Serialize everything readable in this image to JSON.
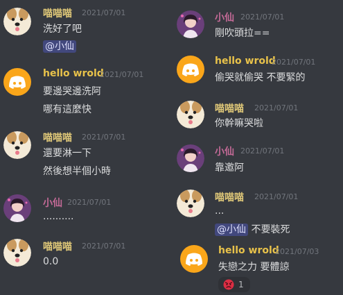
{
  "colors": {
    "background": "#36393f",
    "user_a_name": "#e0c878",
    "user_b_name": "#c46a97",
    "user_c_name": "#e8c24a",
    "discord_avatar_bg": "#faa61a",
    "mention_bg": "#4a4f8a"
  },
  "left_messages": [
    {
      "author": "喵喵喵",
      "timestamp": "2021/07/01",
      "lines": [
        "洗好了吧"
      ],
      "mention": "@小仙"
    },
    {
      "author": "hello wrold",
      "timestamp": "2021/07/01",
      "lines": [
        "要邊哭邊洗阿",
        "哪有這麼快"
      ]
    },
    {
      "author": "喵喵喵",
      "timestamp": "2021/07/01",
      "lines": [
        "還要淋一下",
        "然後想半個小時"
      ]
    },
    {
      "author": "小仙",
      "timestamp": "2021/07/01",
      "lines": [
        ".........."
      ]
    },
    {
      "author": "喵喵喵",
      "timestamp": "2021/07/01",
      "lines": [
        "0.0"
      ]
    }
  ],
  "right_messages": [
    {
      "author": "小仙",
      "timestamp": "2021/07/01",
      "lines": [
        "剛吹頭拉=="
      ]
    },
    {
      "author": "hello wrold",
      "timestamp": "2021/07/01",
      "lines": [
        "偷哭就偷哭 不要緊的"
      ]
    },
    {
      "author": "喵喵喵",
      "timestamp": "2021/07/01",
      "lines": [
        "你幹嘛哭啦"
      ]
    },
    {
      "author": "小仙",
      "timestamp": "2021/07/01",
      "lines": [
        "靠邀阿"
      ]
    },
    {
      "author": "喵喵喵",
      "timestamp": "2021/07/01",
      "lines": [
        "..."
      ],
      "mention": "@小仙",
      "mention_suffix": " 不要裝死"
    },
    {
      "author": "hello wrold",
      "timestamp": "2021/07/03",
      "lines": [
        "失戀之力 要體諒"
      ],
      "reaction": {
        "emoji": "angry-face",
        "count": "1"
      }
    }
  ]
}
